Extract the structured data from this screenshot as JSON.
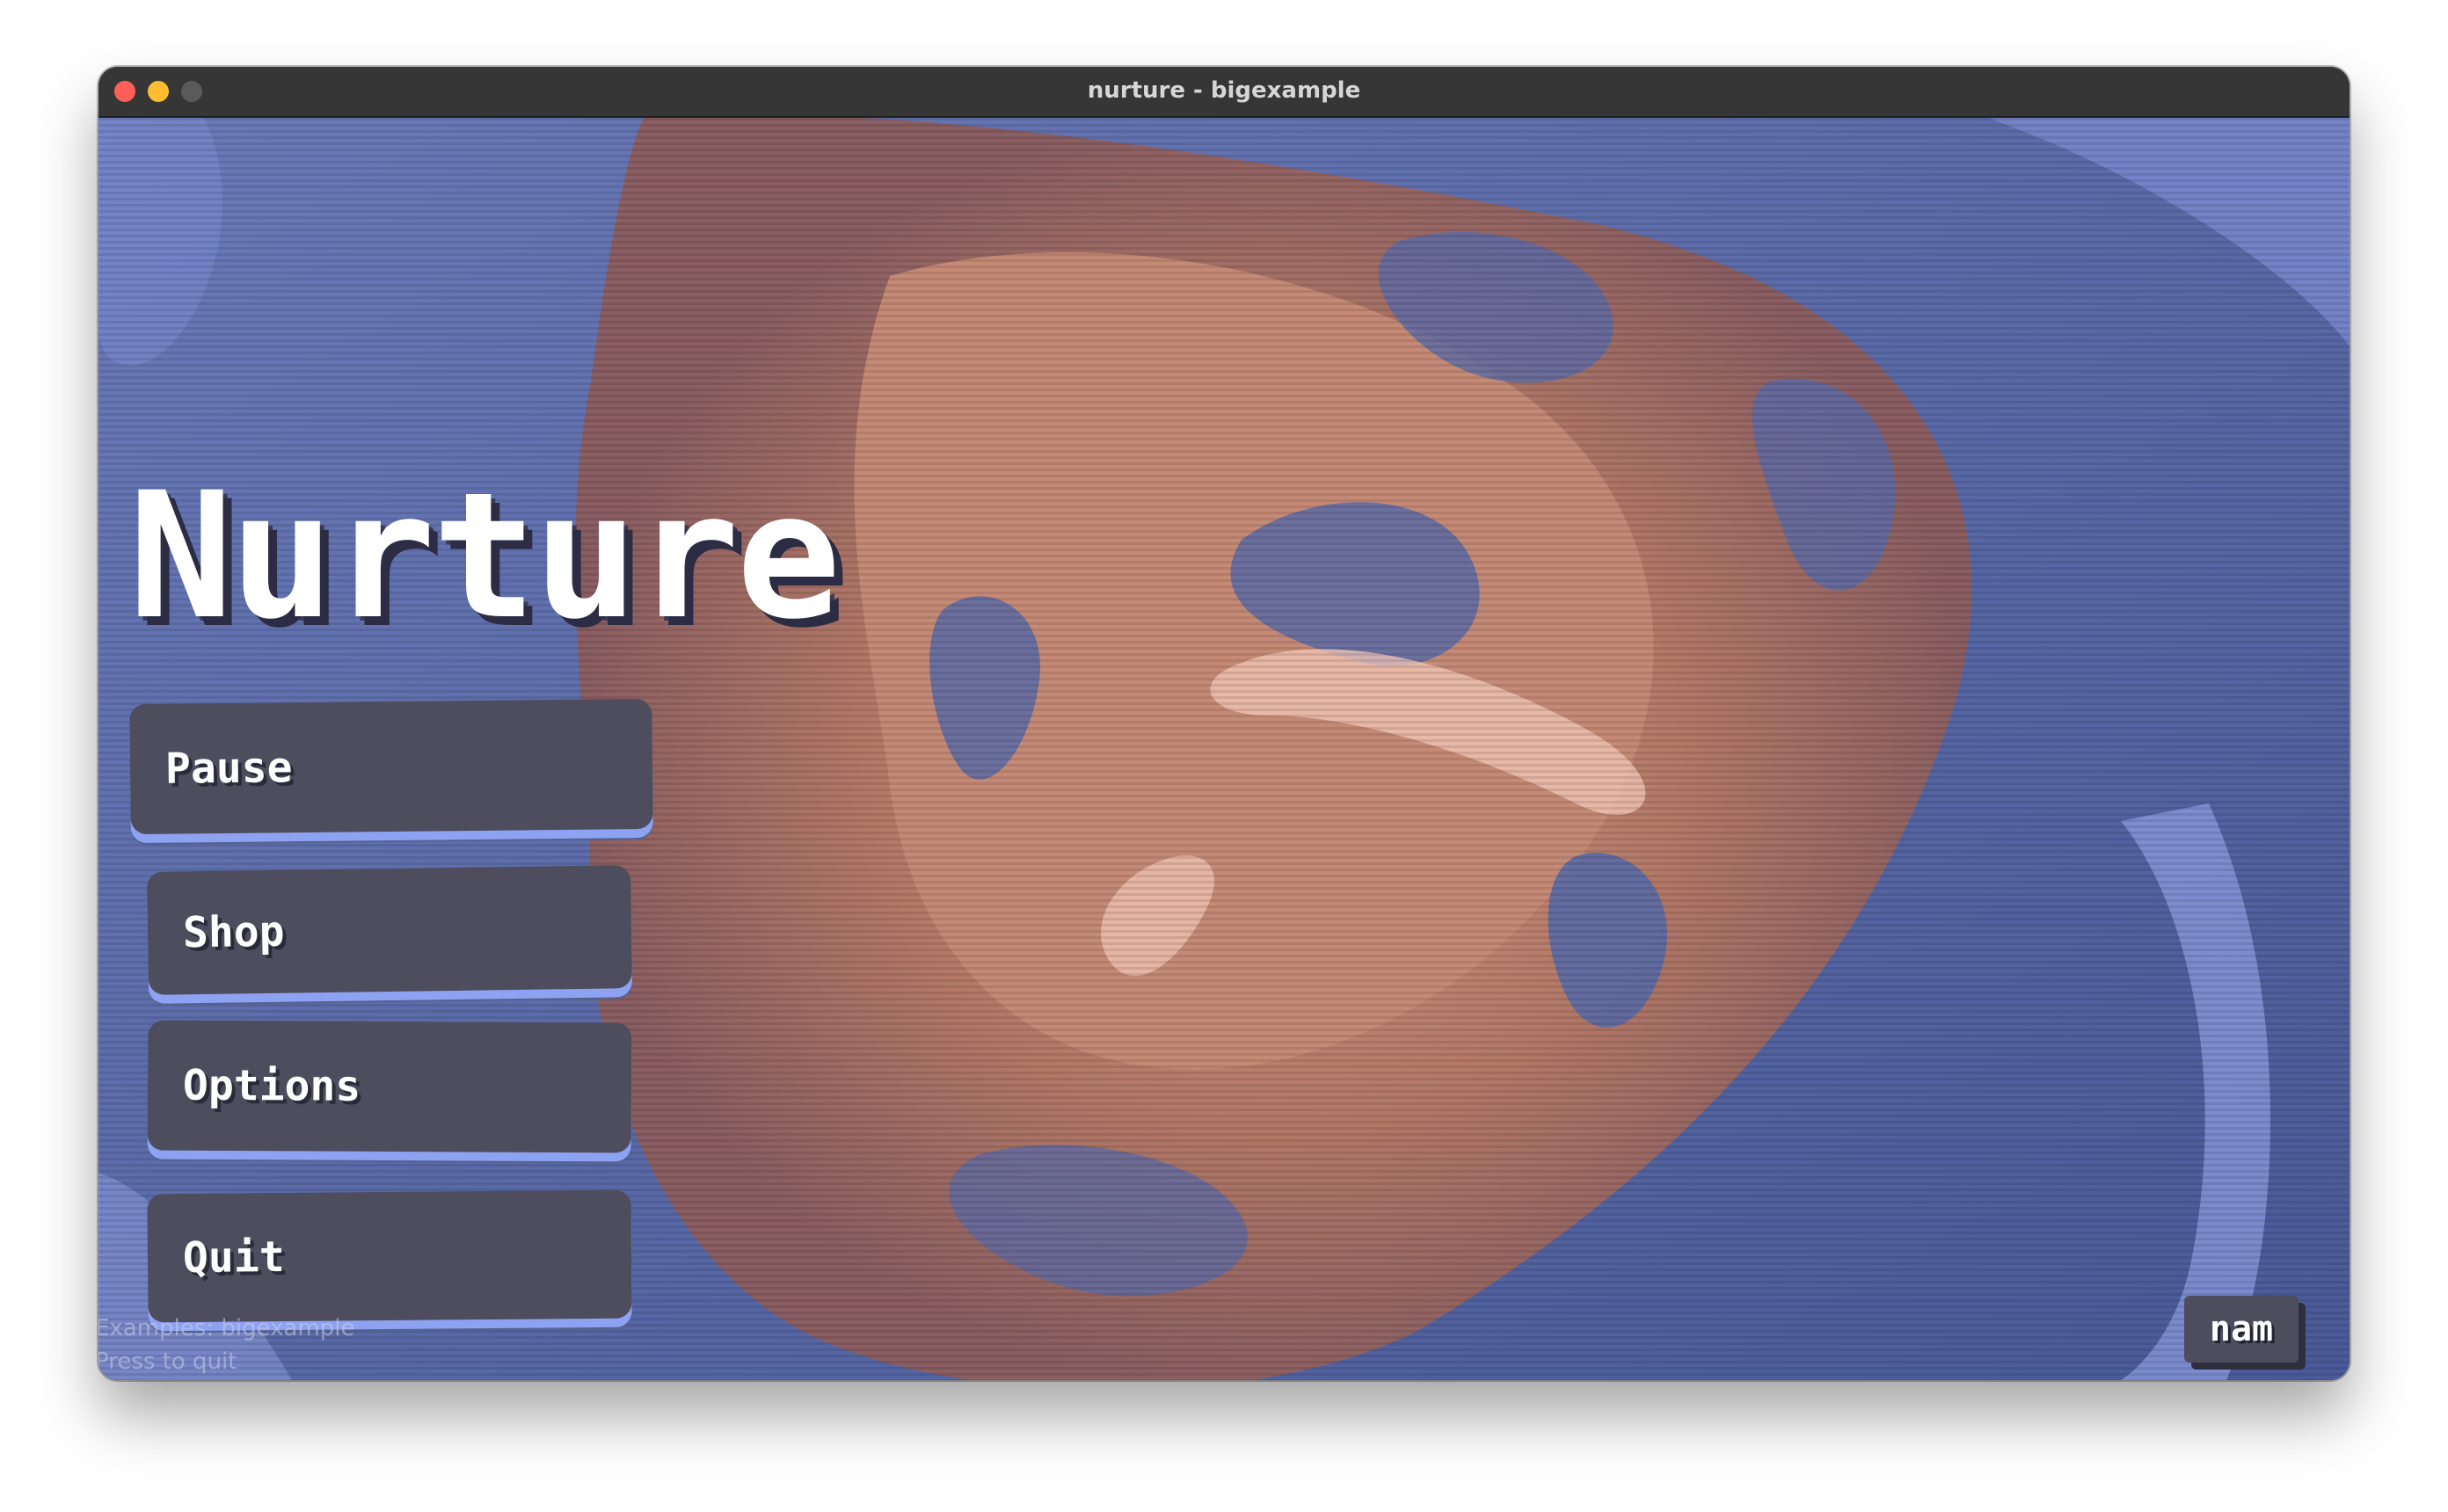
{
  "window": {
    "title": "nurture - bigexample"
  },
  "game": {
    "title": "Nurture",
    "menu": {
      "pause_label": "Pause",
      "shop_label": "Shop",
      "options_label": "Options",
      "quit_label": "Quit"
    },
    "debug_line_1": "Examples: bigexample",
    "debug_line_2": "Press  to quit",
    "name_badge": "nam"
  },
  "colors": {
    "background_blue": "#5a6aa6",
    "background_copper": "#b07a68",
    "button_fill": "#4d4d5e",
    "button_accent": "#8ea2f2",
    "title_text": "#ffffff"
  }
}
